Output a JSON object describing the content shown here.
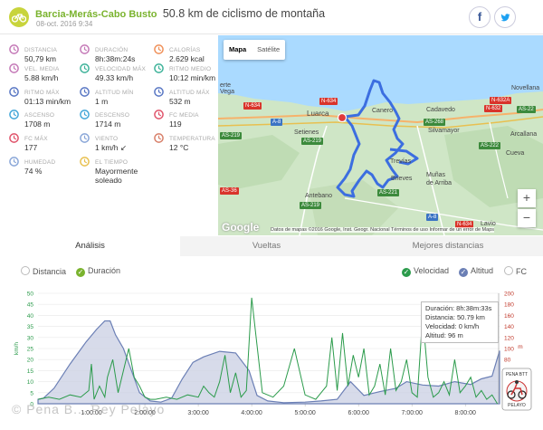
{
  "header": {
    "title_link": "Barcia-Merás-Cabo Busto",
    "title_rest": "50.8 km de ciclismo de montaña",
    "date": "08-oct. 2016 9:34",
    "facebook_label": "f",
    "twitter_label": "t"
  },
  "stats": [
    {
      "label": "Distancia",
      "value": "50,79 km",
      "icon": "distance-icon",
      "color": "#c57ab8"
    },
    {
      "label": "Duración",
      "value": "8h:38m:24s",
      "icon": "duration-icon",
      "color": "#c57ab8"
    },
    {
      "label": "Calorías",
      "value": "2.629 kcal",
      "icon": "flame-icon",
      "color": "#f0915a"
    },
    {
      "label": "Vel. media",
      "value": "5.88 km/h",
      "icon": "speed-avg-icon",
      "color": "#c57ab8"
    },
    {
      "label": "Velocidad máx",
      "value": "49.33 km/h",
      "icon": "speed-max-icon",
      "color": "#3fb39a"
    },
    {
      "label": "Ritmo medio",
      "value": "10:12 min/km",
      "icon": "pace-avg-icon",
      "color": "#3fb39a"
    },
    {
      "label": "Ritmo máx",
      "value": "01:13 min/km",
      "icon": "pace-max-icon",
      "color": "#5a78c4"
    },
    {
      "label": "Altitud mín",
      "value": "1 m",
      "icon": "altitude-min-icon",
      "color": "#5a78c4"
    },
    {
      "label": "Altitud máx",
      "value": "532 m",
      "icon": "altitude-max-icon",
      "color": "#5a78c4"
    },
    {
      "label": "Ascenso",
      "value": "1708 m",
      "icon": "ascent-icon",
      "color": "#42a6d8"
    },
    {
      "label": "Descenso",
      "value": "1714 m",
      "icon": "descent-icon",
      "color": "#42a6d8"
    },
    {
      "label": "FC media",
      "value": "119",
      "icon": "heart-avg-icon",
      "color": "#e0546b"
    },
    {
      "label": "FC máx",
      "value": "177",
      "icon": "heart-max-icon",
      "color": "#e0546b"
    },
    {
      "label": "Viento",
      "value": "1 km/h ↙",
      "icon": "wind-icon",
      "color": "#8aa7d8"
    },
    {
      "label": "Temperatura",
      "value": "12 °C",
      "icon": "thermometer-icon",
      "color": "#d8806a"
    },
    {
      "label": "Humedad",
      "value": "74 %",
      "icon": "humidity-icon",
      "color": "#8aa7d8"
    },
    {
      "label": "El tiempo",
      "value": "Mayormente soleado",
      "icon": "weather-icon",
      "color": "#e8c050"
    }
  ],
  "map": {
    "tab_map": "Mapa",
    "tab_satellite": "Satélite",
    "zoom_in": "+",
    "zoom_out": "−",
    "google": "Google",
    "attribution": "Datos de mapas ©2016 Google, Inst. Geogr. Nacional   Términos de uso   Informar de un error de Maps",
    "places": {
      "vega": "Vega",
      "luarca": "Luarca",
      "setienes": "Setienes",
      "canero": "Canero",
      "cadavedo": "Cadavedo",
      "silvamayor": "Silvamayor",
      "novellana": "Novellana",
      "arcallana": "Arcallana",
      "cueva": "Cueva",
      "trevias": "Trevías",
      "brieves": "Brieves",
      "munas": "Muñas\nde Arriba",
      "antebano": "Antebano",
      "lavio": "Lavio",
      "erte": "erte"
    },
    "roads": {
      "n634a": "N-634",
      "a8": "A-8",
      "n634b": "N-634",
      "n632": "N-632",
      "as219a": "AS-219",
      "as219b": "AS-219",
      "as219c": "AS-219",
      "as268": "AS-268",
      "as222": "AS-222",
      "as221": "AS-221",
      "as36": "AS-36",
      "n634c": "N-634",
      "n632a": "N-632A",
      "a8b": "A-8",
      "as22": "AS-22"
    }
  },
  "tabs": [
    "Análisis",
    "Vueltas",
    "Mejores distancias"
  ],
  "legend": {
    "distance": "Distancia",
    "duration": "Duración",
    "speed": "Velocidad",
    "altitude": "Altitud",
    "hr": "FC"
  },
  "tooltip": {
    "line1": "Duración: 8h:38m:33s",
    "line2": "Distancia: 50.79 km",
    "line3": "Velocidad: 0 km/h",
    "line4": "Altitud: 96 m"
  },
  "copyright": "© Pena B...  Rey Pelayo",
  "chart_data": {
    "type": "line",
    "title": "",
    "xlabel": "",
    "ylabel": "km/h",
    "ylabel_right": "m",
    "x_ticks": [
      "1:00:00",
      "2:00:00",
      "3:00:00",
      "4:00:00",
      "5:00:00",
      "6:00:00",
      "7:00:00",
      "8:00:00"
    ],
    "y_ticks_left": [
      0,
      5,
      10,
      15,
      20,
      25,
      30,
      35,
      40,
      45,
      50
    ],
    "y_ticks_right": [
      0,
      20,
      40,
      60,
      80,
      100,
      120,
      140,
      160,
      180,
      200
    ],
    "xlim_hours": [
      0,
      8.64
    ],
    "ylim_left": [
      0,
      50
    ],
    "ylim_right": [
      0,
      200
    ],
    "series": [
      {
        "name": "Altitud",
        "axis": "right",
        "color": "#6b7fb5",
        "x": [
          0,
          0.1,
          0.3,
          0.6,
          0.9,
          1.1,
          1.25,
          1.35,
          1.45,
          1.6,
          1.75,
          1.9,
          2.1,
          2.3,
          2.5,
          2.7,
          2.9,
          3.1,
          3.4,
          3.7,
          3.95,
          4.1,
          4.3,
          4.6,
          5.0,
          5.3,
          5.6,
          5.85,
          6.1,
          6.4,
          6.7,
          6.9,
          7.2,
          7.5,
          7.8,
          8.1,
          8.3,
          8.5,
          8.64
        ],
        "y": [
          8,
          10,
          28,
          72,
          112,
          135,
          150,
          150,
          125,
          100,
          60,
          20,
          5,
          3,
          10,
          45,
          75,
          85,
          95,
          92,
          60,
          15,
          5,
          2,
          3,
          5,
          8,
          40,
          15,
          22,
          28,
          40,
          34,
          32,
          40,
          35,
          45,
          50,
          96
        ]
      },
      {
        "name": "Velocidad",
        "axis": "left",
        "color": "#2b9b4b",
        "x": [
          0,
          0.2,
          0.4,
          0.6,
          0.8,
          0.95,
          1.0,
          1.05,
          1.15,
          1.25,
          1.3,
          1.4,
          1.5,
          1.6,
          1.7,
          1.8,
          1.9,
          2.0,
          2.1,
          2.2,
          2.4,
          2.6,
          2.8,
          3.0,
          3.1,
          3.2,
          3.3,
          3.4,
          3.5,
          3.6,
          3.7,
          3.8,
          3.9,
          4.0,
          4.2,
          4.4,
          4.6,
          4.8,
          5.0,
          5.1,
          5.2,
          5.3,
          5.4,
          5.5,
          5.6,
          5.7,
          5.8,
          5.9,
          6.0,
          6.1,
          6.2,
          6.3,
          6.4,
          6.5,
          6.6,
          6.7,
          6.8,
          6.9,
          7.0,
          7.1,
          7.2,
          7.3,
          7.4,
          7.5,
          7.6,
          7.7,
          7.8,
          7.9,
          8.0,
          8.1,
          8.2,
          8.3,
          8.4,
          8.5,
          8.6
        ],
        "y": [
          2,
          3,
          2,
          4,
          3,
          6,
          18,
          2,
          8,
          3,
          12,
          20,
          5,
          15,
          25,
          12,
          8,
          3,
          2,
          2,
          3,
          2,
          4,
          3,
          8,
          5,
          3,
          10,
          22,
          5,
          14,
          3,
          6,
          48,
          5,
          3,
          8,
          25,
          4,
          3,
          2,
          5,
          8,
          30,
          6,
          32,
          8,
          22,
          12,
          25,
          4,
          8,
          18,
          4,
          25,
          6,
          10,
          20,
          5,
          3,
          40,
          12,
          3,
          5,
          10,
          4,
          20,
          5,
          8,
          12,
          3,
          6,
          2,
          4,
          0
        ]
      }
    ]
  }
}
